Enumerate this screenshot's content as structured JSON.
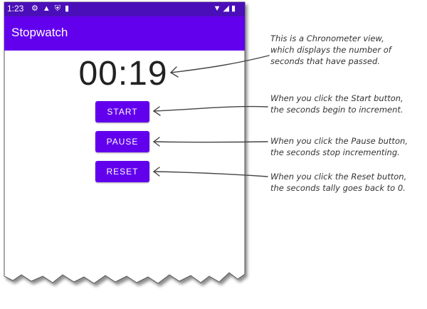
{
  "status_bar": {
    "time": "1:23",
    "left_icons": [
      "gear-icon",
      "a-icon",
      "shield-icon",
      "sd-card-icon"
    ],
    "right_icons": [
      "wifi-icon",
      "signal-icon",
      "battery-icon"
    ]
  },
  "app_bar": {
    "title": "Stopwatch"
  },
  "chronometer": {
    "value": "00:19"
  },
  "buttons": {
    "start": "START",
    "pause": "PAUSE",
    "reset": "RESET"
  },
  "annotations": [
    {
      "line1": "This is a Chronometer view,",
      "line2": "which displays the number of",
      "line3": "seconds that have passed."
    },
    {
      "line1": "When you click the Start button,",
      "line2": "the seconds begin to increment."
    },
    {
      "line1": "When you click the Pause button,",
      "line2": "the seconds stop incrementing."
    },
    {
      "line1": "When you click the Reset button,",
      "line2": "the seconds tally goes back to 0."
    }
  ],
  "colors": {
    "accent": "#6200ee",
    "status_bar": "#4a0fb8",
    "text": "#222222"
  }
}
